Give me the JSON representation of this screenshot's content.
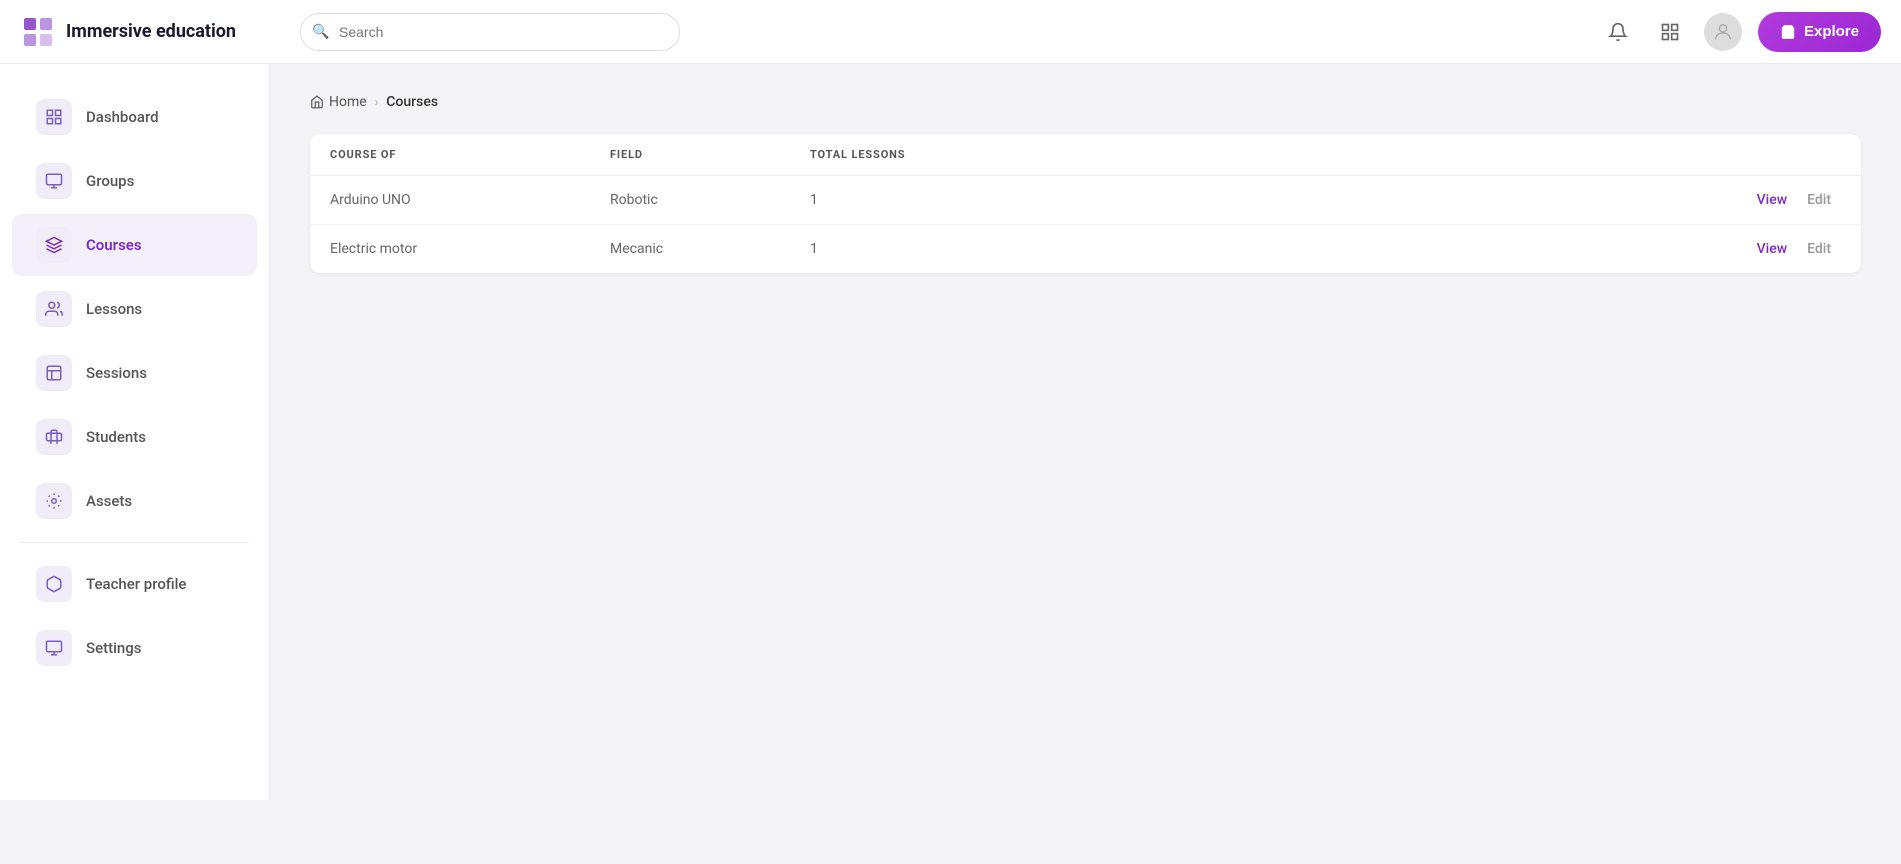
{
  "app": {
    "title": "Immersive education",
    "explore_label": "Explore"
  },
  "search": {
    "placeholder": "Search"
  },
  "navbar": {
    "bell_icon": "🔔",
    "grid_icon": "⊞",
    "avatar_icon": "👤"
  },
  "sidebar": {
    "items": [
      {
        "id": "dashboard",
        "label": "Dashboard",
        "icon": "⊞"
      },
      {
        "id": "groups",
        "label": "Groups",
        "icon": "▣"
      },
      {
        "id": "courses",
        "label": "Courses",
        "icon": "🚀",
        "active": true
      },
      {
        "id": "lessons",
        "label": "Lessons",
        "icon": "👤"
      },
      {
        "id": "sessions",
        "label": "Sessions",
        "icon": "📊"
      },
      {
        "id": "students",
        "label": "Students",
        "icon": "🎓"
      },
      {
        "id": "assets",
        "label": "Assets",
        "icon": "🔧"
      },
      {
        "id": "teacher-profile",
        "label": "Teacher profile",
        "icon": "📦"
      },
      {
        "id": "settings",
        "label": "Settings",
        "icon": "▣"
      }
    ],
    "divider_after": [
      "assets"
    ]
  },
  "breadcrumb": {
    "home_label": "Home",
    "current_label": "Courses"
  },
  "table": {
    "columns": [
      "COURSE OF",
      "FIELD",
      "TOTAL LESSONS",
      "",
      "",
      ""
    ],
    "rows": [
      {
        "course": "Arduino UNO",
        "field": "Robotic",
        "total_lessons": "1",
        "view_label": "View",
        "edit_label": "Edit"
      },
      {
        "course": "Electric motor",
        "field": "Mecanic",
        "total_lessons": "1",
        "view_label": "View",
        "edit_label": "Edit"
      }
    ]
  }
}
